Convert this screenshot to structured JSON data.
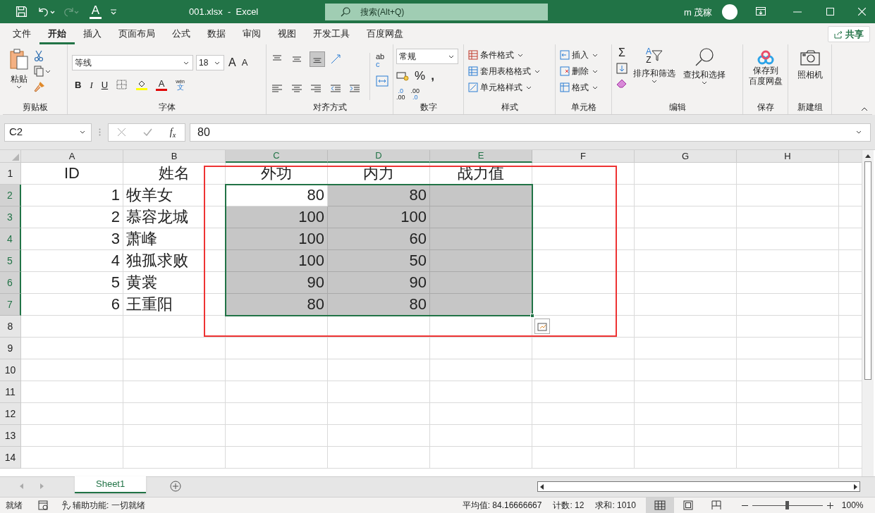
{
  "title_bar": {
    "font_color_letter": "A",
    "title": "001.xlsx  -  Excel",
    "search_placeholder": "搜索(Alt+Q)",
    "user": "m 茂稼"
  },
  "menu_tabs": [
    {
      "label": "文件",
      "selected": false
    },
    {
      "label": "开始",
      "selected": true
    },
    {
      "label": "插入",
      "selected": false
    },
    {
      "label": "页面布局",
      "selected": false
    },
    {
      "label": "公式",
      "selected": false
    },
    {
      "label": "数据",
      "selected": false
    },
    {
      "label": "审阅",
      "selected": false
    },
    {
      "label": "视图",
      "selected": false
    },
    {
      "label": "开发工具",
      "selected": false
    },
    {
      "label": "百度网盘",
      "selected": false
    }
  ],
  "share_button": "共享",
  "ribbon": {
    "paste": "粘贴",
    "clipboard_group": "剪贴板",
    "font_name": "等线",
    "font_size": "18",
    "grow_font": "A",
    "shrink_font": "A",
    "bold": "B",
    "italic": "I",
    "underline": "U",
    "font_color": "A",
    "phonetic_top": "wén",
    "phonetic_bottom": "文",
    "font_group": "字体",
    "wrap_top": "ab",
    "wrap_bottom": "c",
    "align_group": "对齐方式",
    "number_format": "常规",
    "percent": "%",
    "comma": ",",
    "inc_decimal_top": ".0",
    "inc_decimal_bottom": ".00",
    "dec_decimal_top": ".00",
    "dec_decimal_bottom": ".0",
    "number_group": "数字",
    "conditional_format": "条件格式",
    "table_format": "套用表格格式",
    "cell_styles": "单元格样式",
    "styles_group": "样式",
    "insert": "插入",
    "delete": "删除",
    "format": "格式",
    "cells_group": "单元格",
    "sum": "Σ",
    "sort_a": "A",
    "sort_z": "Z",
    "sort_filter": "排序和筛选",
    "find_select": "查找和选择",
    "editing_group": "编辑",
    "save_baidu_line1": "保存到",
    "save_baidu_line2": "百度网盘",
    "save_group": "保存",
    "camera": "照相机",
    "new_group": "新建组"
  },
  "formula_bar": {
    "name_box": "C2",
    "fx": "f$_{x}$",
    "formula": "80"
  },
  "sheet": {
    "columns": [
      {
        "label": "A",
        "kind": "number",
        "selected": false
      },
      {
        "label": "B",
        "kind": "text",
        "selected": false
      },
      {
        "label": "C",
        "kind": "number",
        "selected": true
      },
      {
        "label": "D",
        "kind": "number",
        "selected": true
      },
      {
        "label": "E",
        "kind": "number",
        "selected": true
      },
      {
        "label": "F",
        "kind": "text",
        "selected": false
      },
      {
        "label": "G",
        "kind": "text",
        "selected": false
      },
      {
        "label": "H",
        "kind": "text",
        "selected": false
      }
    ],
    "rows": [
      {
        "label": "1",
        "kind": "header",
        "selected": false,
        "cells": {
          "A": "ID",
          "B": "姓名",
          "C": "外功",
          "D": "内力",
          "E": "战力值"
        }
      },
      {
        "label": "2",
        "kind": "data",
        "selected": true,
        "cells": {
          "A": "1",
          "B": "牧羊女",
          "C": "80",
          "D": "80"
        }
      },
      {
        "label": "3",
        "kind": "data",
        "selected": true,
        "cells": {
          "A": "2",
          "B": "慕容龙城",
          "C": "100",
          "D": "100"
        }
      },
      {
        "label": "4",
        "kind": "data",
        "selected": true,
        "cells": {
          "A": "3",
          "B": "萧峰",
          "C": "100",
          "D": "60"
        }
      },
      {
        "label": "5",
        "kind": "data",
        "selected": true,
        "cells": {
          "A": "4",
          "B": "独孤求败",
          "C": "100",
          "D": "50"
        }
      },
      {
        "label": "6",
        "kind": "data",
        "selected": true,
        "cells": {
          "A": "5",
          "B": "黄裳",
          "C": "90",
          "D": "90"
        }
      },
      {
        "label": "7",
        "kind": "data",
        "selected": true,
        "cells": {
          "A": "6",
          "B": "王重阳",
          "C": "80",
          "D": "80"
        }
      },
      {
        "label": "8",
        "kind": "data",
        "selected": false,
        "cells": {}
      },
      {
        "label": "9",
        "kind": "data",
        "selected": false,
        "cells": {}
      },
      {
        "label": "10",
        "kind": "data",
        "selected": false,
        "cells": {}
      },
      {
        "label": "11",
        "kind": "data",
        "selected": false,
        "cells": {}
      },
      {
        "label": "12",
        "kind": "data",
        "selected": false,
        "cells": {}
      },
      {
        "label": "13",
        "kind": "data",
        "selected": false,
        "cells": {}
      },
      {
        "label": "14",
        "kind": "data",
        "selected": false,
        "cells": {}
      }
    ]
  },
  "sheet_tabs": [
    {
      "label": "Sheet1",
      "selected": true
    }
  ],
  "status_bar": {
    "ready": "就绪",
    "accessibility": "辅助功能: 一切就绪",
    "average": "平均值: 84.16666667",
    "count": "计数: 12",
    "sum": "求和: 1010",
    "views": [
      {
        "kind": "normal",
        "selected": true
      },
      {
        "kind": "page_layout",
        "selected": false
      },
      {
        "kind": "page_break",
        "selected": false
      }
    ],
    "zoom": {
      "level": 0.5
    },
    "zoom_text": "100%"
  }
}
